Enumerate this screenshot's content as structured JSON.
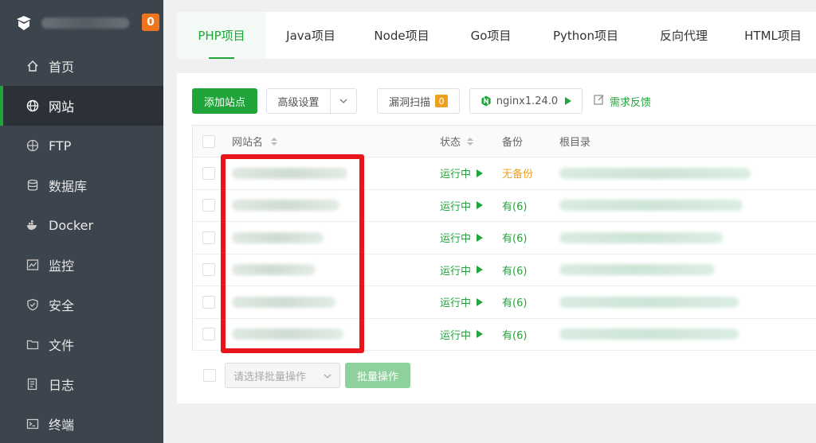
{
  "brand": {
    "badge": "0"
  },
  "sidebar": {
    "items": [
      {
        "label": "首页",
        "icon": "home-icon"
      },
      {
        "label": "网站",
        "icon": "globe-icon",
        "active": true
      },
      {
        "label": "FTP",
        "icon": "ftp-icon"
      },
      {
        "label": "数据库",
        "icon": "database-icon"
      },
      {
        "label": "Docker",
        "icon": "docker-icon"
      },
      {
        "label": "监控",
        "icon": "monitor-icon"
      },
      {
        "label": "安全",
        "icon": "shield-icon"
      },
      {
        "label": "文件",
        "icon": "folder-icon"
      },
      {
        "label": "日志",
        "icon": "log-icon"
      },
      {
        "label": "终端",
        "icon": "terminal-icon"
      }
    ]
  },
  "tabs": [
    {
      "label": "PHP项目",
      "active": true
    },
    {
      "label": "Java项目"
    },
    {
      "label": "Node项目"
    },
    {
      "label": "Go项目"
    },
    {
      "label": "Python项目"
    },
    {
      "label": "反向代理"
    },
    {
      "label": "HTML项目"
    }
  ],
  "toolbar": {
    "add_site": "添加站点",
    "advanced": "高级设置",
    "vuln_scan": "漏洞扫描",
    "vuln_count": "0",
    "nginx": "nginx1.24.0",
    "feedback": "需求反馈"
  },
  "table": {
    "headers": {
      "name": "网站名",
      "status": "状态",
      "backup": "备份",
      "root": "根目录"
    },
    "rows": [
      {
        "status": "运行中",
        "backup": "无备份",
        "backup_state": "none"
      },
      {
        "status": "运行中",
        "backup": "有(6)",
        "backup_state": "has"
      },
      {
        "status": "运行中",
        "backup": "有(6)",
        "backup_state": "has"
      },
      {
        "status": "运行中",
        "backup": "有(6)",
        "backup_state": "has"
      },
      {
        "status": "运行中",
        "backup": "有(6)",
        "backup_state": "has"
      },
      {
        "status": "运行中",
        "backup": "有(6)",
        "backup_state": "has"
      }
    ]
  },
  "batch": {
    "placeholder": "请选择批量操作",
    "button": "批量操作"
  },
  "colors": {
    "accent": "#20a53a",
    "sidebar": "#3c444d",
    "badge": "#f0741b",
    "warning": "#f0a020",
    "annotation": "#e8141b"
  }
}
